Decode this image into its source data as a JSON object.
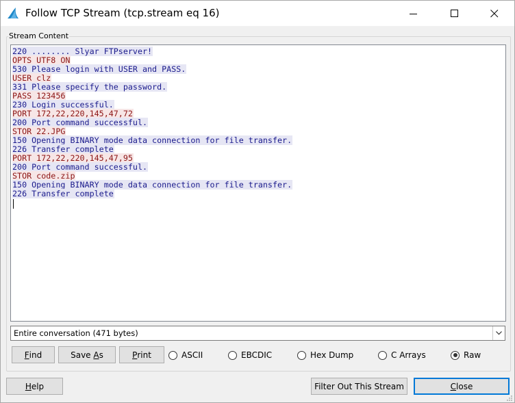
{
  "window": {
    "title": "Follow TCP Stream (tcp.stream eq 16)"
  },
  "stream": {
    "group_label": "Stream Content",
    "lines": [
      {
        "who": "server",
        "text": "220 ........ Slyar FTPserver!"
      },
      {
        "who": "client",
        "text": "OPTS UTF8 ON"
      },
      {
        "who": "server",
        "text": "530 Please login with USER and PASS."
      },
      {
        "who": "client",
        "text": "USER clz"
      },
      {
        "who": "server",
        "text": "331 Please specify the password."
      },
      {
        "who": "client",
        "text": "PASS 123456"
      },
      {
        "who": "server",
        "text": "230 Login successful."
      },
      {
        "who": "client",
        "text": "PORT 172,22,220,145,47,72"
      },
      {
        "who": "server",
        "text": "200 Port command successful."
      },
      {
        "who": "client",
        "text": "STOR 22.JPG"
      },
      {
        "who": "server",
        "text": "150 Opening BINARY mode data connection for file transfer."
      },
      {
        "who": "server",
        "text": "226 Transfer complete"
      },
      {
        "who": "client",
        "text": "PORT 172,22,220,145,47,95"
      },
      {
        "who": "server",
        "text": "200 Port command successful."
      },
      {
        "who": "client",
        "text": "STOR code.zip"
      },
      {
        "who": "server",
        "text": "150 Opening BINARY mode data connection for file transfer."
      },
      {
        "who": "server",
        "text": "226 Transfer complete"
      }
    ]
  },
  "conversation_select": {
    "value": "Entire conversation (471 bytes)"
  },
  "toolbar": {
    "find": {
      "pre": "",
      "ul": "F",
      "post": "ind"
    },
    "save_as": {
      "pre": "Save ",
      "ul": "A",
      "post": "s"
    },
    "print": {
      "pre": "",
      "ul": "P",
      "post": "rint"
    }
  },
  "format": {
    "options": [
      {
        "label": "ASCII",
        "checked": false
      },
      {
        "label": "EBCDIC",
        "checked": false
      },
      {
        "label": "Hex Dump",
        "checked": false
      },
      {
        "label": "C Arrays",
        "checked": false
      },
      {
        "label": "Raw",
        "checked": true
      }
    ]
  },
  "footer": {
    "help": {
      "pre": "",
      "ul": "H",
      "post": "elp"
    },
    "filter_out": "Filter Out This Stream",
    "close": {
      "pre": "",
      "ul": "C",
      "post": "lose"
    }
  },
  "colors": {
    "server_text": "#1a1a8c",
    "server_bg": "#e6e6f4",
    "client_text": "#8c1414",
    "client_bg": "#f7e6e6",
    "accent": "#0078d7",
    "icon": "#1e88c8"
  },
  "icons": {
    "app": "wireshark-fin-icon",
    "minimize": "minimize-icon",
    "maximize": "maximize-icon",
    "close": "close-icon",
    "dropdown": "chevron-down-icon"
  }
}
